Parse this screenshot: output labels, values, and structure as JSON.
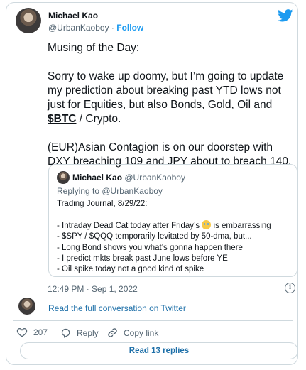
{
  "author": {
    "name": "Michael Kao",
    "handle": "@UrbanKaoboy",
    "separator": "·",
    "follow_label": "Follow"
  },
  "tweet": {
    "paragraph1": "Musing of the Day:",
    "paragraph2_before": "Sorry to wake up doomy, but I’m going to update my prediction about breaking past YTD lows not just for Equities, but also Bonds, Gold, Oil and ",
    "cashtag": "$BTC",
    "paragraph2_after": " / Crypto.",
    "paragraph3": "(EUR)Asian Contagion is on our doorstep with DXY breaching 109 and JPY about to breach 140."
  },
  "quoted": {
    "name": "Michael Kao",
    "handle": "@UrbanKaoboy",
    "replying_to": "Replying to @UrbanKaoboy",
    "title": "Trading Journal, 8/29/22:",
    "bullet1_before": "- Intraday Dead Cat today after Friday’s ",
    "bullet1_after": " is embarrassing",
    "bullet2": "- $SPY / $QQQ temporarily levitated by 50-dma, but...",
    "bullet3": "- Long Bond shows you what’s gonna happen there",
    "bullet4": "- I predict mkts break past June lows before YE",
    "bullet5": "- Oil spike today not a good kind of spike"
  },
  "timestamp": "12:49 PM · Sep 1, 2022",
  "info_label": "i",
  "read_full_label": "Read the full conversation on Twitter",
  "actions": {
    "likes": "207",
    "reply_label": "Reply",
    "copy_link_label": "Copy link"
  },
  "read_replies_label": "Read 13 replies",
  "colors": {
    "accent": "#1d9bf0",
    "link": "#1d6fa8",
    "secondary_text": "#536471",
    "border": "#cfd9de"
  },
  "icons": [
    "twitter-bird-icon",
    "heart-icon",
    "reply-bubble-icon",
    "link-icon",
    "info-icon",
    "crying-emoji-icon"
  ]
}
